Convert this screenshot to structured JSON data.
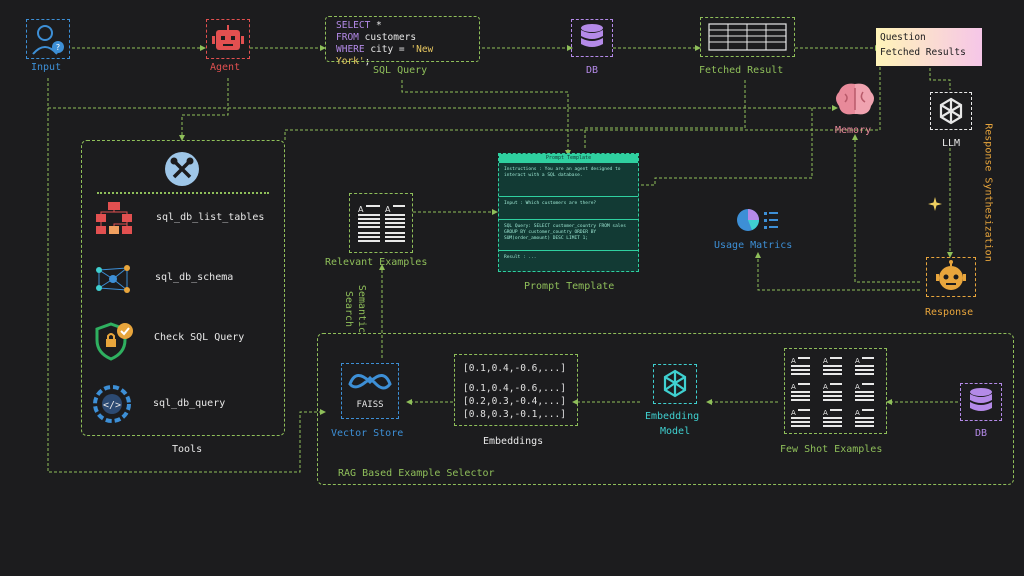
{
  "nodes": {
    "input": "Input",
    "agent": "Agent",
    "sql_query": "SQL Query",
    "db": "DB",
    "fetched_result": "Fetched Result",
    "memory": "Memory",
    "llm": "LLM",
    "tools": "Tools",
    "relevant_examples": "Relevant Examples",
    "prompt_template": "Prompt Template",
    "usage_matrics": "Usage Matrics",
    "response": "Response",
    "response_synthesization": "Response Synthesization",
    "semantic_search": "Semantic Search",
    "vector_store": "Vector Store",
    "faiss": "FAISS",
    "embeddings": "Embeddings",
    "embedding_model_line1": "Embedding",
    "embedding_model_line2": "Model",
    "few_shot_examples": "Few Shot Examples",
    "db2": "DB",
    "rag_selector": "RAG Based Example Selector"
  },
  "sql_code": {
    "line1_kw": "SELECT",
    "line1_rest": " *",
    "line2_kw": "FROM",
    "line2_rest": " customers",
    "line3_kw": "WHERE",
    "line3_rest": " city = ",
    "line3_str": "'New York'",
    "line3_end": ";"
  },
  "question_box": {
    "line1": "Question",
    "line2": "Fetched Results"
  },
  "tools_list": [
    "sql_db_list_tables",
    "sql_db_schema",
    "Check SQL Query",
    "sql_db_query"
  ],
  "embeddings_rows": {
    "top": "[0.1,0.4,-0.6,...]",
    "r1": "[0.1,0.4,-0.6,...]",
    "r2": "[0.2,0.3,-0.4,...]",
    "r3": "[0.8,0.3,-0.1,...]"
  },
  "prompt_card": {
    "title": "Prompt Template",
    "s1": "Instructions : You are an agent designed to interact with a SQL database.",
    "s2": "Input : Which customers are there?",
    "s3": "SQL Query: SELECT customer_country FROM sales GROUP BY customer_country ORDER BY SUM(order_amount) DESC LIMIT 1;",
    "s4": "Result : ..."
  },
  "colors": {
    "background": "#1c1c1e",
    "wire": "#8fbf5a",
    "blue": "#3d8fd6",
    "red": "#e25050",
    "purple": "#b48ae8",
    "orange": "#e8a53c",
    "teal": "#2fd0a0"
  },
  "icons": [
    "user-icon",
    "robot-icon",
    "database-icon",
    "table-icon",
    "brain-icon",
    "openai-icon",
    "tools-icon",
    "flowchart-icon",
    "network-icon",
    "shield-check-icon",
    "gear-code-icon",
    "document-icon",
    "pie-chart-icon",
    "sparkle-icon",
    "bot-face-icon",
    "infinity-icon"
  ]
}
